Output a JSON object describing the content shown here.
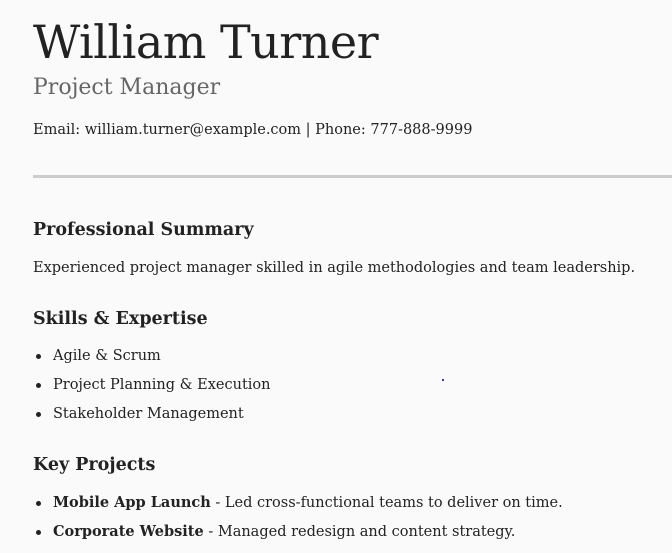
{
  "header": {
    "name": "William Turner",
    "role": "Project Manager",
    "contact": "Email: william.turner@example.com | Phone: 777-888-9999"
  },
  "summary": {
    "heading": "Professional Summary",
    "text": "Experienced project manager skilled in agile methodologies and team leadership."
  },
  "skills": {
    "heading": "Skills & Expertise",
    "items": [
      "Agile & Scrum",
      "Project Planning & Execution",
      "Stakeholder Management"
    ]
  },
  "projects": {
    "heading": "Key Projects",
    "items": [
      {
        "title": "Mobile App Launch",
        "description": " - Led cross-functional teams to deliver on time."
      },
      {
        "title": "Corporate Website",
        "description": " - Managed redesign and content strategy."
      }
    ]
  }
}
